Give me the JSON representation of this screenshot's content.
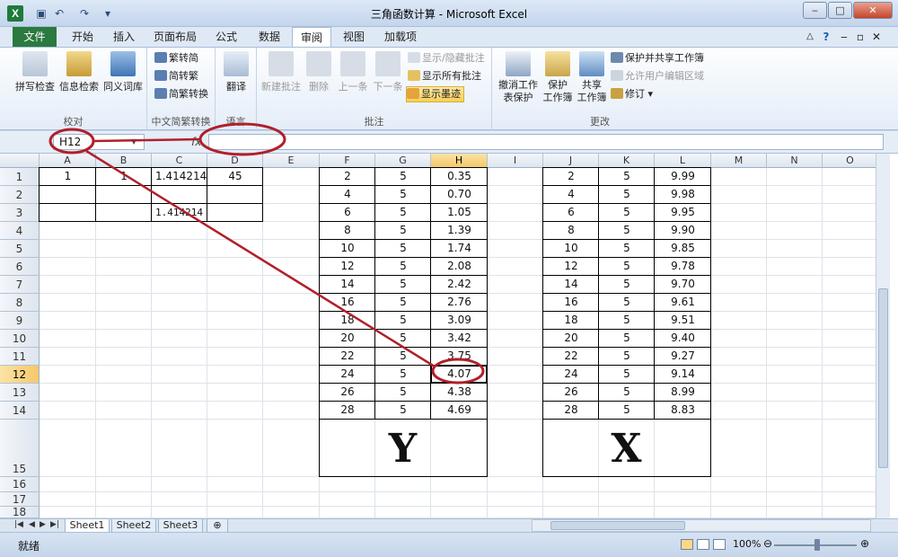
{
  "window": {
    "title": "三角函数计算 - Microsoft Excel",
    "logo": "X"
  },
  "menu": {
    "file": "文件",
    "tabs": [
      "开始",
      "插入",
      "页面布局",
      "公式",
      "数据",
      "审阅",
      "视图",
      "加载项"
    ],
    "active": "审阅"
  },
  "ribbon": {
    "proofing": {
      "label": "校对",
      "spell": "拼写检查",
      "research": "信息检索",
      "thesaurus": "同义词库"
    },
    "chinese": {
      "label": "中文简繁转换",
      "to_simplified": "繁转简",
      "to_traditional": "简转繁",
      "convert": "简繁转换"
    },
    "language": {
      "label": "语言",
      "translate": "翻译"
    },
    "comments": {
      "label": "批注",
      "new": "新建批注",
      "delete": "删除",
      "prev": "上一条",
      "next": "下一条",
      "show_hide": "显示/隐藏批注",
      "show_all": "显示所有批注",
      "show_ink": "显示墨迹"
    },
    "changes": {
      "label": "更改",
      "unprotect_sheet": [
        "撤消工作",
        "表保护"
      ],
      "protect_workbook": [
        "保护",
        "工作簿"
      ],
      "share_workbook": [
        "共享",
        "工作簿"
      ],
      "protect_share": "保护并共享工作簿",
      "allow_edit": "允许用户编辑区域",
      "track_changes": "修订"
    }
  },
  "formula_bar": {
    "name_box": "H12",
    "fx": "fx",
    "value": ""
  },
  "columns": [
    "A",
    "B",
    "C",
    "D",
    "E",
    "F",
    "G",
    "H",
    "I",
    "J",
    "K",
    "L",
    "M",
    "N",
    "O"
  ],
  "selected_column": "H",
  "rows": [
    "1",
    "2",
    "3",
    "4",
    "5",
    "6",
    "7",
    "8",
    "9",
    "10",
    "11",
    "12",
    "13",
    "14",
    "15",
    "16",
    "17",
    "18"
  ],
  "selected_row": "12",
  "cells_left": {
    "A1": "1",
    "B1": "1",
    "C1": "1.414214",
    "D1": "45",
    "C3": "1.414214"
  },
  "table_y": {
    "F": [
      "2",
      "4",
      "6",
      "8",
      "10",
      "12",
      "14",
      "16",
      "18",
      "20",
      "22",
      "24",
      "26",
      "28"
    ],
    "G": [
      "5",
      "5",
      "5",
      "5",
      "5",
      "5",
      "5",
      "5",
      "5",
      "5",
      "5",
      "5",
      "5",
      "5"
    ],
    "H": [
      "0.35",
      "0.70",
      "1.05",
      "1.39",
      "1.74",
      "2.08",
      "2.42",
      "2.76",
      "3.09",
      "3.42",
      "3.75",
      "4.07",
      "4.38",
      "4.69"
    ],
    "label": "Y"
  },
  "table_x": {
    "J": [
      "2",
      "4",
      "6",
      "8",
      "10",
      "12",
      "14",
      "16",
      "18",
      "20",
      "22",
      "24",
      "26",
      "28"
    ],
    "K": [
      "5",
      "5",
      "5",
      "5",
      "5",
      "5",
      "5",
      "5",
      "5",
      "5",
      "5",
      "5",
      "5",
      "5"
    ],
    "L": [
      "9.99",
      "9.98",
      "9.95",
      "9.90",
      "9.85",
      "9.78",
      "9.70",
      "9.61",
      "9.51",
      "9.40",
      "9.27",
      "9.14",
      "8.99",
      "8.83"
    ],
    "label": "X"
  },
  "sheets": [
    "Sheet1",
    "Sheet2",
    "Sheet3"
  ],
  "active_sheet": "Sheet1",
  "status": {
    "ready": "就绪",
    "zoom": "100%"
  },
  "annotation_color": "#b0202a"
}
